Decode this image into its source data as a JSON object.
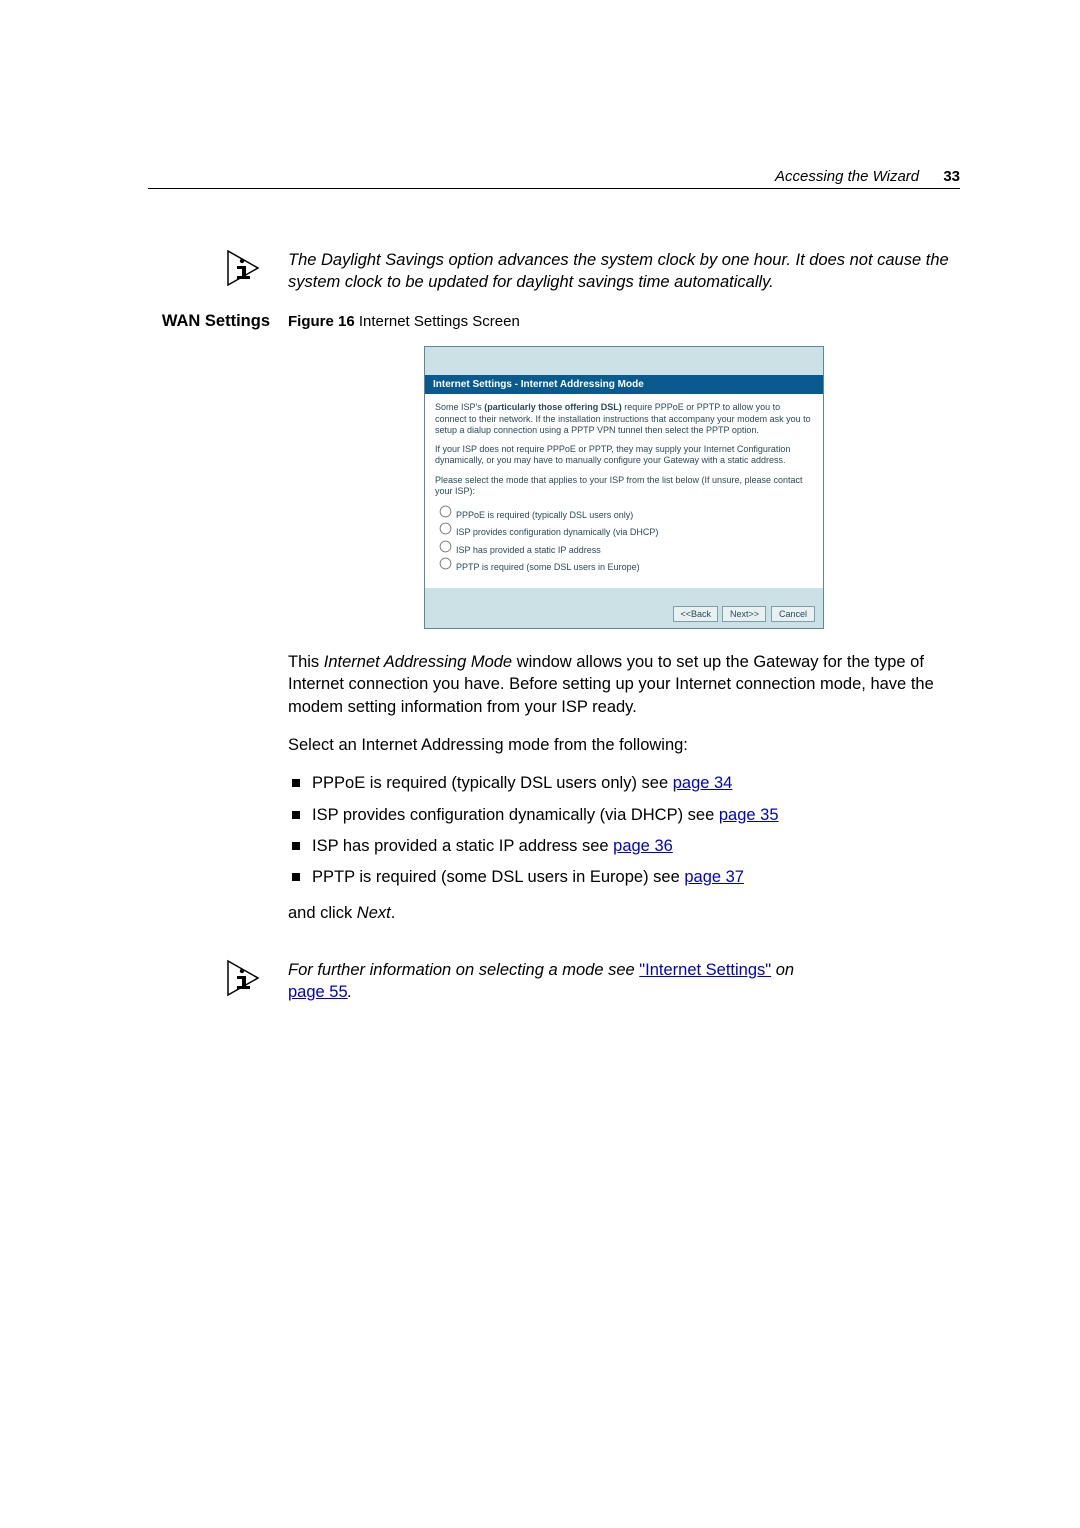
{
  "header": {
    "section": "Accessing the Wizard",
    "page": "33"
  },
  "note1": "The Daylight Savings option advances the system clock by one hour. It does not cause the system clock to be updated for daylight savings time automatically.",
  "wan": {
    "label": "WAN Settings",
    "figure_bold": "Figure 16",
    "figure_caption": "   Internet Settings Screen"
  },
  "screenshot": {
    "title": "Internet Settings - Internet Addressing Mode",
    "p1a": "Some ISP's ",
    "p1b": "(particularly those offering DSL)",
    "p1c": " require PPPoE or PPTP to allow you to connect to their network. If the installation instructions that accompany your modem ask you to setup a dialup connection using a PPTP VPN tunnel then select the PPTP option.",
    "p2": "If your ISP does not require PPPoE or PPTP, they may supply your Internet Configuration dynamically, or you may have to manually configure your Gateway with a static address.",
    "p3": "Please select the mode that applies to your ISP from the list below (If unsure, please contact your ISP):",
    "r1": "PPPoE is required (typically DSL users only)",
    "r2": "ISP provides configuration dynamically (via DHCP)",
    "r3": "ISP has provided a static IP address",
    "r4": "PPTP is required (some DSL users in Europe)",
    "btn_back": "<<Back",
    "btn_next": "Next>>",
    "btn_cancel": "Cancel"
  },
  "para1a": "This ",
  "para1b": "Internet Addressing Mode",
  "para1c": " window allows you to set up the Gateway for the type of Internet connection you have. Before setting up your Internet connection mode, have the modem setting information from your ISP ready.",
  "para2": "Select an Internet Addressing mode from the following:",
  "bullets": {
    "b1a": "PPPoE is required (typically DSL users only) see ",
    "b1link": "page 34",
    "b2a": "ISP provides configuration dynamically (via DHCP) see ",
    "b2link": "page 35",
    "b3a": "ISP has provided a static IP address see ",
    "b3link": "page 36",
    "b4a": "PPTP is required (some DSL users in Europe) see ",
    "b4link": "page 37"
  },
  "para3a": "and click ",
  "para3b": "Next",
  "para3c": ".",
  "note2a": "For further information on selecting a mode see ",
  "note2link": "\"Internet Settings\"",
  "note2b": " on ",
  "note2link2": "page 55",
  "note2c": "."
}
